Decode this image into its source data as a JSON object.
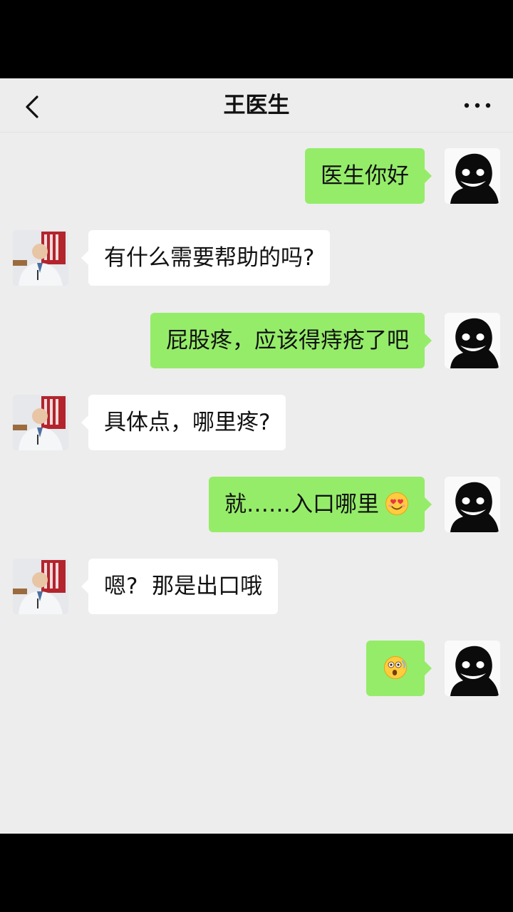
{
  "header": {
    "title": "王医生",
    "back_icon": "chevron-left-icon",
    "more_icon": "more-dots-icon"
  },
  "colors": {
    "my_bubble": "#95ec69",
    "their_bubble": "#ffffff",
    "background": "#ededed"
  },
  "messages": [
    {
      "sender": "me",
      "text": "医生你好"
    },
    {
      "sender": "doctor",
      "text": "有什么需要帮助的吗?"
    },
    {
      "sender": "me",
      "text": "屁股疼，应该得痔疮了吧"
    },
    {
      "sender": "doctor",
      "text": "具体点，哪里疼?"
    },
    {
      "sender": "me",
      "text": "就……入口哪里",
      "emoji": "smiling-heart-eyes-emoji"
    },
    {
      "sender": "doctor",
      "text": "嗯?  那是出口哦"
    },
    {
      "sender": "me",
      "text": "",
      "emoji": "shocked-face-emoji"
    }
  ]
}
